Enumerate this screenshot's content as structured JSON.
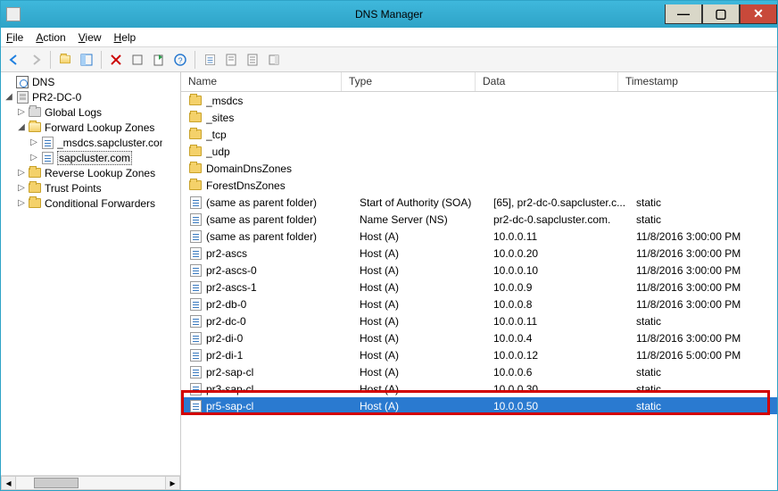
{
  "window": {
    "title": "DNS Manager"
  },
  "menus": {
    "file": "File",
    "action": "Action",
    "view": "View",
    "help": "Help"
  },
  "tree": {
    "root": "DNS",
    "server": "PR2-DC-0",
    "nodes": {
      "global_logs": "Global Logs",
      "flz": "Forward Lookup Zones",
      "msdcs": "_msdcs.sapcluster.com",
      "sapcluster": "sapcluster.com",
      "rlz": "Reverse Lookup Zones",
      "trust": "Trust Points",
      "cond": "Conditional Forwarders"
    }
  },
  "columns": {
    "name": "Name",
    "type": "Type",
    "data": "Data",
    "ts": "Timestamp"
  },
  "folders": [
    {
      "name": "_msdcs"
    },
    {
      "name": "_sites"
    },
    {
      "name": "_tcp"
    },
    {
      "name": "_udp"
    },
    {
      "name": "DomainDnsZones"
    },
    {
      "name": "ForestDnsZones"
    }
  ],
  "records": [
    {
      "name": "(same as parent folder)",
      "type": "Start of Authority (SOA)",
      "data": "[65], pr2-dc-0.sapcluster.c...",
      "ts": "static"
    },
    {
      "name": "(same as parent folder)",
      "type": "Name Server (NS)",
      "data": "pr2-dc-0.sapcluster.com.",
      "ts": "static"
    },
    {
      "name": "(same as parent folder)",
      "type": "Host (A)",
      "data": "10.0.0.11",
      "ts": "11/8/2016 3:00:00 PM"
    },
    {
      "name": "pr2-ascs",
      "type": "Host (A)",
      "data": "10.0.0.20",
      "ts": "11/8/2016 3:00:00 PM"
    },
    {
      "name": "pr2-ascs-0",
      "type": "Host (A)",
      "data": "10.0.0.10",
      "ts": "11/8/2016 3:00:00 PM"
    },
    {
      "name": "pr2-ascs-1",
      "type": "Host (A)",
      "data": "10.0.0.9",
      "ts": "11/8/2016 3:00:00 PM"
    },
    {
      "name": "pr2-db-0",
      "type": "Host (A)",
      "data": "10.0.0.8",
      "ts": "11/8/2016 3:00:00 PM"
    },
    {
      "name": "pr2-dc-0",
      "type": "Host (A)",
      "data": "10.0.0.11",
      "ts": "static"
    },
    {
      "name": "pr2-di-0",
      "type": "Host (A)",
      "data": "10.0.0.4",
      "ts": "11/8/2016 3:00:00 PM"
    },
    {
      "name": "pr2-di-1",
      "type": "Host (A)",
      "data": "10.0.0.12",
      "ts": "11/8/2016 5:00:00 PM"
    },
    {
      "name": "pr2-sap-cl",
      "type": "Host (A)",
      "data": "10.0.0.6",
      "ts": "static"
    },
    {
      "name": "pr3-sap-cl",
      "type": "Host (A)",
      "data": "10.0.0.30",
      "ts": "static"
    },
    {
      "name": "pr5-sap-cl",
      "type": "Host (A)",
      "data": "10.0.0.50",
      "ts": "static",
      "selected": true,
      "highlighted": true
    }
  ]
}
